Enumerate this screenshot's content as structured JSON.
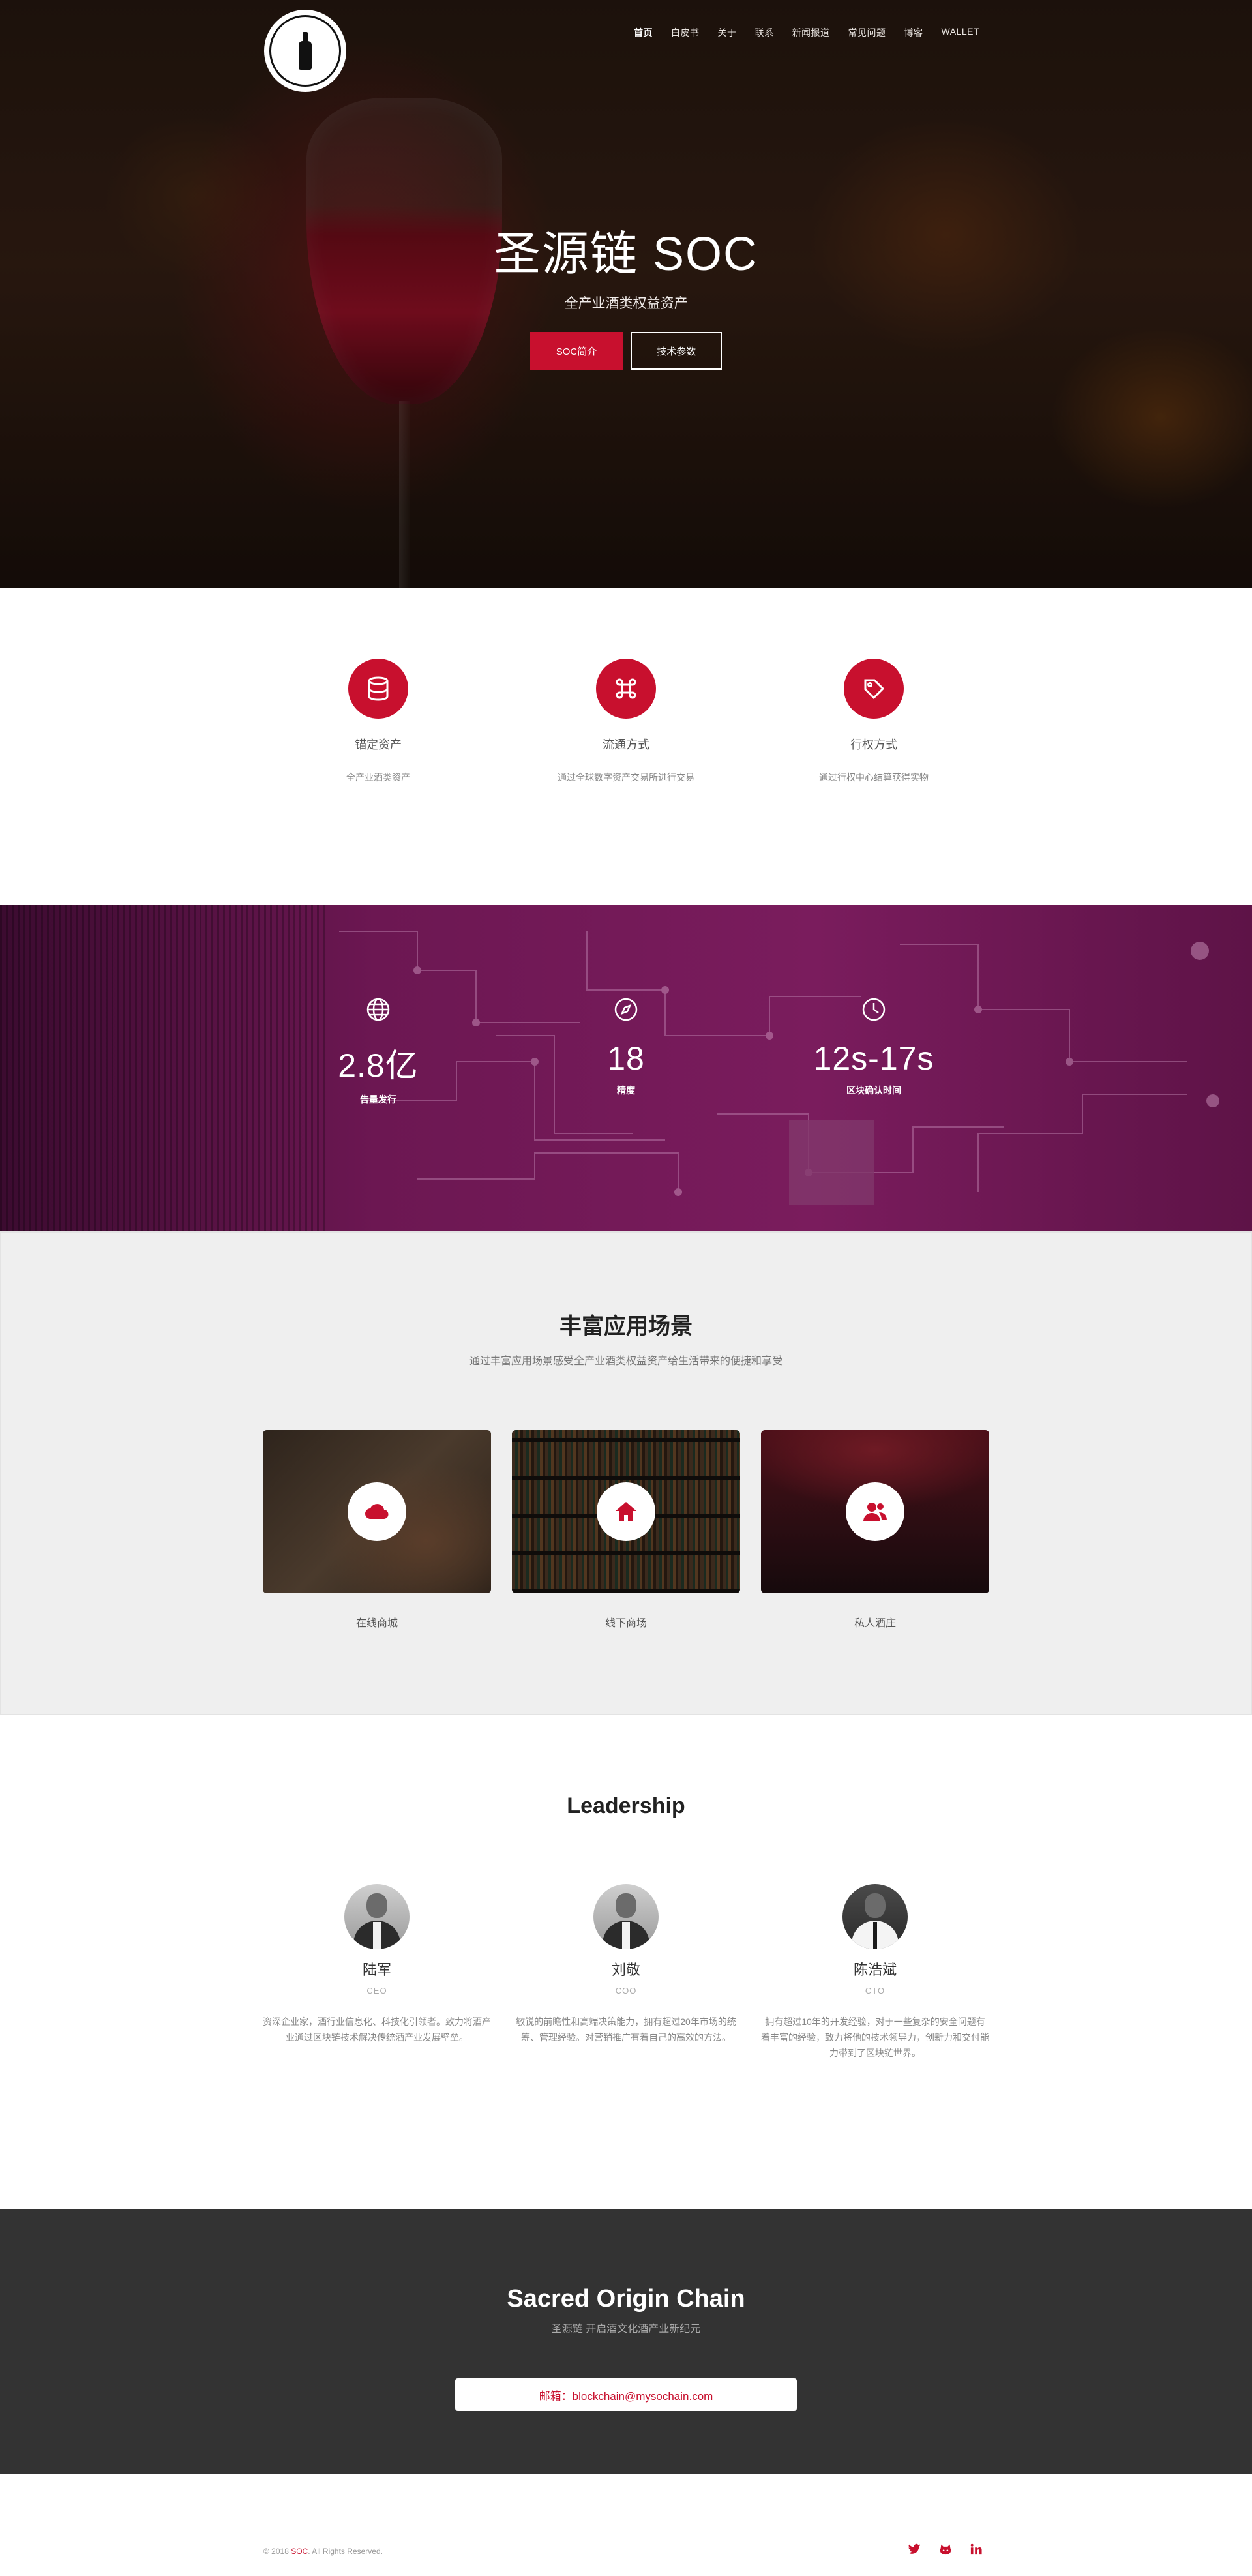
{
  "nav": {
    "items": [
      "首页",
      "白皮书",
      "关于",
      "联系",
      "新闻报道",
      "常见问题",
      "博客",
      "WALLET"
    ],
    "active_index": 0
  },
  "hero": {
    "title": "圣源链 SOC",
    "subtitle": "全产业酒类权益资产",
    "primary_button": "SOC简介",
    "secondary_button": "技术参数"
  },
  "features": [
    {
      "icon": "database-icon",
      "title": "锚定资产",
      "desc": "全产业酒类资产"
    },
    {
      "icon": "command-icon",
      "title": "流通方式",
      "desc": "通过全球数字资产交易所进行交易"
    },
    {
      "icon": "tag-icon",
      "title": "行权方式",
      "desc": "通过行权中心结算获得实物"
    }
  ],
  "stats": [
    {
      "icon": "globe-icon",
      "value": "2.8亿",
      "label": "告量发行"
    },
    {
      "icon": "compass-icon",
      "value": "18",
      "label": "精度"
    },
    {
      "icon": "clock-icon",
      "value": "12s-17s",
      "label": "区块确认时间"
    }
  ],
  "scenes": {
    "title": "丰富应用场景",
    "subtitle": "通过丰富应用场景感受全产业酒类权益资产给生活带来的便捷和享受",
    "items": [
      {
        "icon": "cloud-icon",
        "label": "在线商城"
      },
      {
        "icon": "home-icon",
        "label": "线下商场"
      },
      {
        "icon": "users-icon",
        "label": "私人酒庄"
      }
    ]
  },
  "leadership": {
    "title": "Leadership",
    "members": [
      {
        "name": "陆军",
        "role": "CEO",
        "bio": "资深企业家，酒行业信息化、科技化引领者。致力将酒产业通过区块链技术解决传统酒产业发展壁垒。"
      },
      {
        "name": "刘敬",
        "role": "COO",
        "bio": "敏锐的前瞻性和高端决策能力，拥有超过20年市场的统筹、管理经验。对营销推广有着自己的高效的方法。"
      },
      {
        "name": "陈浩斌",
        "role": "CTO",
        "bio": "拥有超过10年的开发经验，对于一些复杂的安全问题有着丰富的经验，致力将他的技术领导力，创新力和交付能力带到了区块链世界。"
      }
    ]
  },
  "contact": {
    "title": "Sacred Origin Chain",
    "subtitle": "圣源链 开启酒文化酒产业新纪元",
    "email_label": "邮箱：blockchain@mysochain.com"
  },
  "footer": {
    "copyright_prefix": "© 2018 ",
    "brand": "SOC",
    "copyright_suffix": ". All Rights Reserved.",
    "social": [
      "twitter-icon",
      "github-icon",
      "linkedin-icon"
    ]
  },
  "colors": {
    "accent": "#c8102e",
    "dark_section": "#333333",
    "light_section": "#efefef"
  }
}
